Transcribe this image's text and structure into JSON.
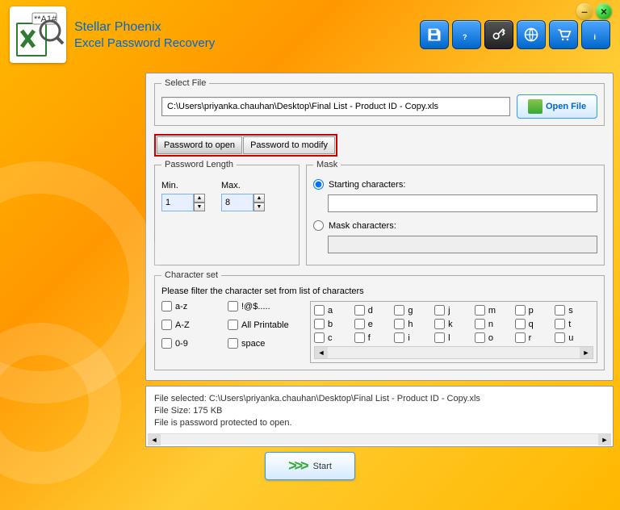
{
  "app": {
    "title": "Stellar Phoenix",
    "subtitle": "Excel Password Recovery"
  },
  "toolbar_icons": [
    "save",
    "help",
    "key",
    "globe",
    "cart",
    "info"
  ],
  "select_file": {
    "legend": "Select File",
    "path": "C:\\Users\\priyanka.chauhan\\Desktop\\Final List - Product ID - Copy.xls",
    "open_label": "Open File"
  },
  "tabs": {
    "open": "Password to open",
    "modify": "Password to modify"
  },
  "password_length": {
    "legend": "Password Length",
    "min_label": "Min.",
    "max_label": "Max.",
    "min_value": "1",
    "max_value": "8"
  },
  "mask": {
    "legend": "Mask",
    "starting_label": "Starting characters:",
    "mask_label": "Mask characters:",
    "starting_value": "",
    "mask_value": ""
  },
  "charset": {
    "legend": "Character set",
    "instruction": "Please filter the character set from list of characters",
    "az": "a-z",
    "AZ": "A-Z",
    "num": "0-9",
    "sym": "!@$.....",
    "printable": "All Printable",
    "space": "space",
    "grid": [
      "a",
      "d",
      "g",
      "j",
      "m",
      "p",
      "s",
      "b",
      "e",
      "h",
      "k",
      "n",
      "q",
      "t",
      "c",
      "f",
      "i",
      "l",
      "o",
      "r",
      "u"
    ]
  },
  "status": {
    "line1": "File selected: C:\\Users\\priyanka.chauhan\\Desktop\\Final List - Product ID - Copy.xls",
    "line2": "File Size: 175 KB",
    "line3": "File is password protected to open."
  },
  "start_label": "Start"
}
